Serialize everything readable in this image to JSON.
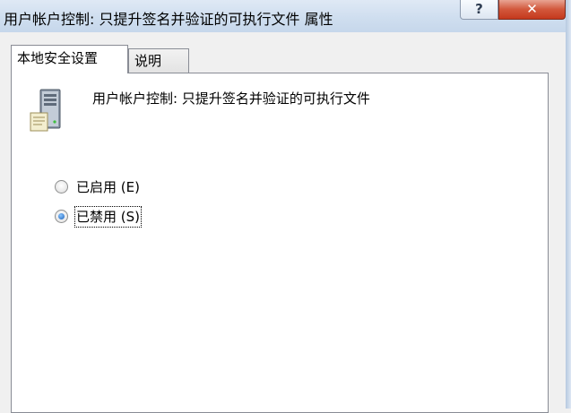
{
  "window": {
    "title": "用户帐户控制: 只提升签名并验证的可执行文件 属性",
    "help_glyph": "?",
    "close_glyph": "✕"
  },
  "tabs": [
    {
      "label": "本地安全设置",
      "active": true
    },
    {
      "label": "说明",
      "active": false
    }
  ],
  "policy": {
    "name": "用户帐户控制: 只提升签名并验证的可执行文件",
    "icon": "server-policy-icon"
  },
  "options": [
    {
      "label": "已启用 (E)",
      "checked": false
    },
    {
      "label": "已禁用 (S)",
      "checked": true,
      "focused": true
    }
  ],
  "colors": {
    "titlebar": "#cfdeef",
    "close_button": "#c5391d",
    "radio_selected": "#1b5fb7"
  }
}
